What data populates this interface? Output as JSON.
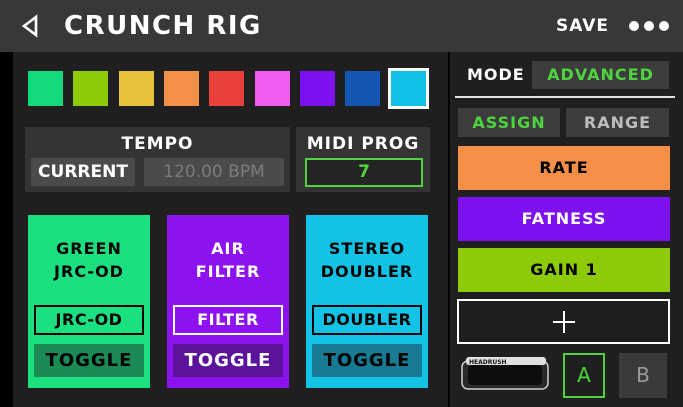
{
  "header": {
    "title": "CRUNCH RIG",
    "save_label": "SAVE",
    "icons": {
      "back": "back-triangle-icon",
      "more": "more-dots-icon"
    }
  },
  "colors": {
    "green_accent": "#4dd43f",
    "swatches": [
      "#12d97b",
      "#8dcb08",
      "#e6c33b",
      "#f58f48",
      "#e8413c",
      "#f05cf0",
      "#7d11f0",
      "#1456b4",
      "#0fc0e4"
    ],
    "selected_swatch_index": 8,
    "rate": "#f58f48",
    "fatness": "#7d11f0",
    "gain": "#8dcb08"
  },
  "tempo": {
    "label": "TEMPO",
    "current_label": "CURRENT",
    "bpm_value": "120.00 BPM"
  },
  "midi": {
    "label": "MIDI PROG",
    "value": "7"
  },
  "cards": [
    {
      "name_line1": "GREEN",
      "name_line2": "JRC-OD",
      "param": "JRC-OD",
      "toggle": "TOGGLE",
      "color": "#1ae080",
      "toggle_color": "#1c8a55",
      "text_color": "#000000"
    },
    {
      "name_line1": "AIR",
      "name_line2": "FILTER",
      "param": "FILTER",
      "toggle": "TOGGLE",
      "color": "#8c12f0",
      "toggle_color": "#5a139a",
      "text_color": "#ffffff"
    },
    {
      "name_line1": "STEREO",
      "name_line2": "DOUBLER",
      "param": "DOUBLER",
      "toggle": "TOGGLE",
      "color": "#12c3e6",
      "toggle_color": "#197b93",
      "text_color": "#000000"
    }
  ],
  "right": {
    "mode_label": "MODE",
    "mode_value": "ADVANCED",
    "assign_tab": "ASSIGN",
    "range_tab": "RANGE",
    "assignments": [
      {
        "label": "RATE",
        "color": "#f58f48",
        "text_color": "#000000"
      },
      {
        "label": "FATNESS",
        "color": "#7d11f0",
        "text_color": "#ffffff"
      },
      {
        "label": "GAIN 1",
        "color": "#8dcb08",
        "text_color": "#000000"
      }
    ],
    "add_icon": "plus-icon",
    "pedal_icon": "expression-pedal-icon",
    "pedal_brand": "HEADRUSH",
    "a_label": "A",
    "b_label": "B"
  }
}
